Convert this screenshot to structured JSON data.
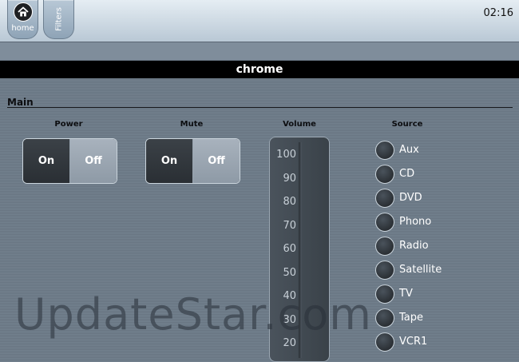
{
  "topbar": {
    "home_label": "home",
    "filters_label": "Filters",
    "clock": "02:16"
  },
  "title": "chrome",
  "section": "Main",
  "power": {
    "label": "Power",
    "on": "On",
    "off": "Off"
  },
  "mute": {
    "label": "Mute",
    "on": "On",
    "off": "Off"
  },
  "volume": {
    "label": "Volume",
    "ticks": [
      "100",
      "90",
      "80",
      "70",
      "60",
      "50",
      "40",
      "30",
      "20"
    ]
  },
  "source": {
    "label": "Source",
    "items": [
      "Aux",
      "CD",
      "DVD",
      "Phono",
      "Radio",
      "Satellite",
      "TV",
      "Tape",
      "VCR1"
    ]
  },
  "watermark": "UpdateStar.com",
  "icons": {
    "home": "home-icon"
  }
}
